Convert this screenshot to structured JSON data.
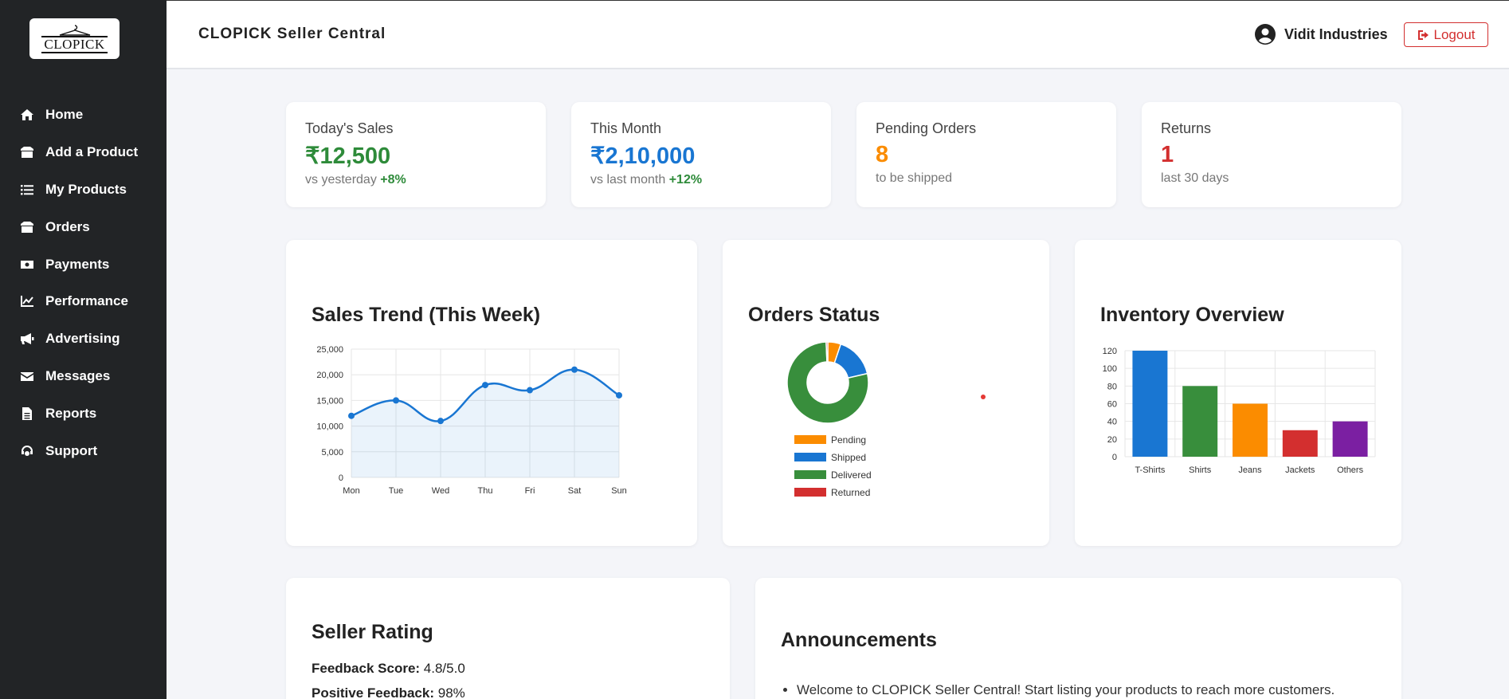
{
  "sidebar": {
    "logo_text": "CLOPICK",
    "items": [
      {
        "label": "Home",
        "icon": "home-icon"
      },
      {
        "label": "Add a Product",
        "icon": "box-plus-icon"
      },
      {
        "label": "My Products",
        "icon": "list-icon"
      },
      {
        "label": "Orders",
        "icon": "boxes-icon"
      },
      {
        "label": "Payments",
        "icon": "money-icon"
      },
      {
        "label": "Performance",
        "icon": "chart-line-icon"
      },
      {
        "label": "Advertising",
        "icon": "megaphone-icon"
      },
      {
        "label": "Messages",
        "icon": "envelope-icon"
      },
      {
        "label": "Reports",
        "icon": "file-icon"
      },
      {
        "label": "Support",
        "icon": "headset-icon"
      }
    ]
  },
  "header": {
    "title": "CLOPICK Seller Central",
    "user_name": "Vidit Industries",
    "logout_label": "Logout"
  },
  "stats": [
    {
      "label": "Today's Sales",
      "value": "₹12,500",
      "sub": "vs yesterday ",
      "delta": "+8%",
      "color": "#2e8b3a"
    },
    {
      "label": "This Month",
      "value": "₹2,10,000",
      "sub": "vs last month ",
      "delta": "+12%",
      "color": "#1976d2"
    },
    {
      "label": "Pending Orders",
      "value": "8",
      "sub": "to be shipped",
      "delta": "",
      "color": "#fb8c00"
    },
    {
      "label": "Returns",
      "value": "1",
      "sub": "last 30 days",
      "delta": "",
      "color": "#d32f2f"
    }
  ],
  "chart_data": [
    {
      "type": "line",
      "title": "Sales Trend (This Week)",
      "x": [
        "Mon",
        "Tue",
        "Wed",
        "Thu",
        "Fri",
        "Sat",
        "Sun"
      ],
      "values": [
        12000,
        15000,
        11000,
        18000,
        17000,
        21000,
        16000
      ],
      "ylim": [
        0,
        25000
      ],
      "yticks": [
        "0",
        "5,000",
        "10,000",
        "15,000",
        "20,000",
        "25,000"
      ],
      "color": "#1976d2",
      "fill": true,
      "grid": true
    },
    {
      "type": "pie",
      "title": "Orders Status",
      "categories": [
        "Pending",
        "Shipped",
        "Delivered",
        "Returned"
      ],
      "values": [
        8,
        25,
        120,
        1
      ],
      "colors": [
        "#fb8c00",
        "#1976d2",
        "#388e3c",
        "#d32f2f"
      ],
      "legend": "bottom"
    },
    {
      "type": "bar",
      "title": "Inventory Overview",
      "categories": [
        "T-Shirts",
        "Shirts",
        "Jeans",
        "Jackets",
        "Others"
      ],
      "values": [
        120,
        80,
        60,
        30,
        40
      ],
      "colors": [
        "#1976d2",
        "#388e3c",
        "#fb8c00",
        "#d32f2f",
        "#7b1fa2"
      ],
      "ylim": [
        0,
        120
      ],
      "yticks": [
        "0",
        "20",
        "40",
        "60",
        "80",
        "100",
        "120"
      ],
      "grid": true
    }
  ],
  "rating": {
    "title": "Seller Rating",
    "feedback_label": "Feedback Score:",
    "feedback_value": "4.8/5.0",
    "positive_label": "Positive Feedback:",
    "positive_value": "98%"
  },
  "announcements": {
    "title": "Announcements",
    "items": [
      "Welcome to CLOPICK Seller Central! Start listing your products to reach more customers."
    ]
  }
}
